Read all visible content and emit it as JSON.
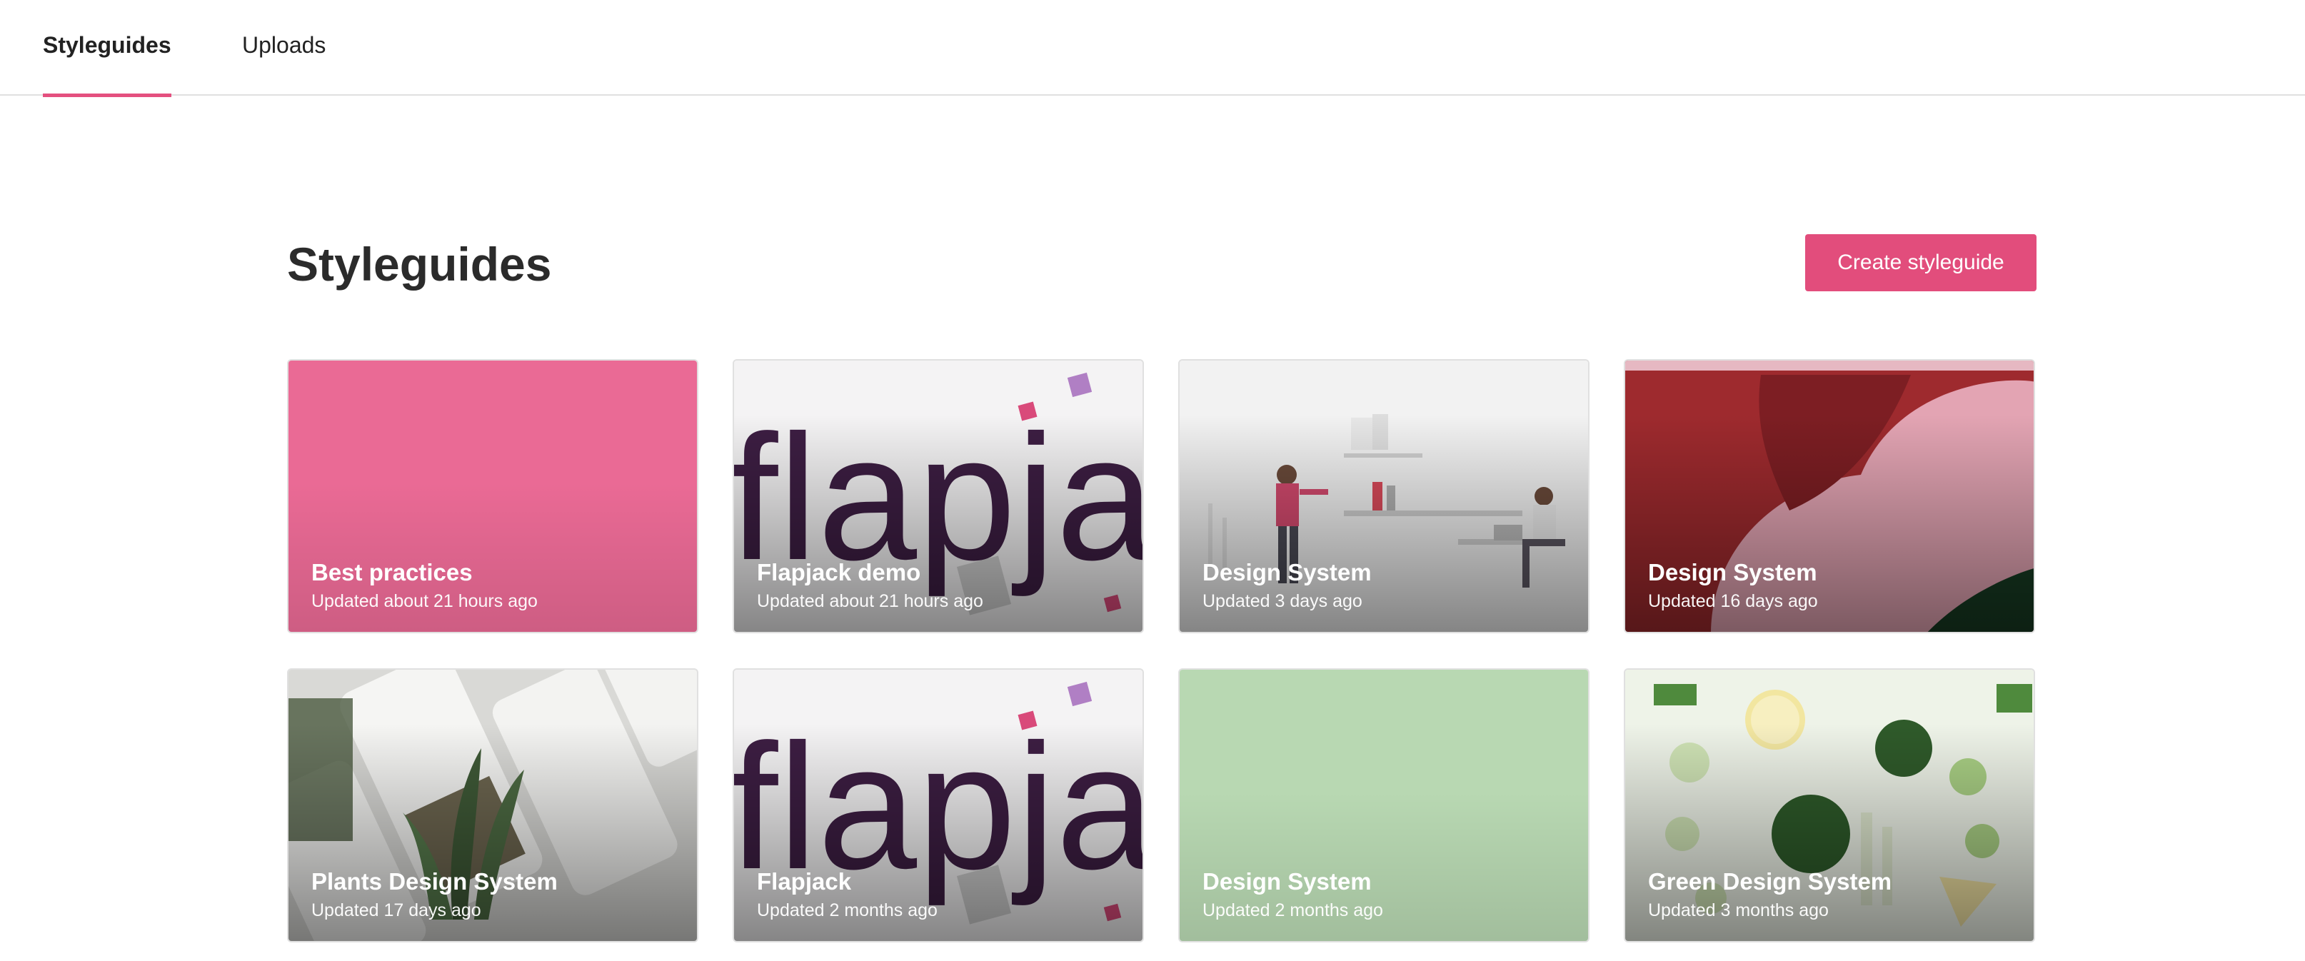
{
  "nav": {
    "tabs": [
      {
        "label": "Styleguides",
        "active": true
      },
      {
        "label": "Uploads",
        "active": false
      }
    ]
  },
  "header": {
    "title": "Styleguides",
    "create_label": "Create styleguide"
  },
  "colors": {
    "accent": "#e24d7c",
    "card_pink": "#ea6a95",
    "card_green": "#b8d8b2",
    "flapjack_text": "#3d1e43"
  },
  "cards": [
    {
      "title": "Best practices",
      "updated": "Updated about 21 hours ago",
      "image": "solid-pink"
    },
    {
      "title": "Flapjack demo",
      "updated": "Updated about 21 hours ago",
      "image": "flapjack-logo"
    },
    {
      "title": "Design System",
      "updated": "Updated 3 days ago",
      "image": "office-illustration"
    },
    {
      "title": "Design System",
      "updated": "Updated 16 days ago",
      "image": "abstract-red-pink"
    },
    {
      "title": "Plants Design System",
      "updated": "Updated 17 days ago",
      "image": "plants-phones"
    },
    {
      "title": "Flapjack",
      "updated": "Updated 2 months ago",
      "image": "flapjack-logo"
    },
    {
      "title": "Design System",
      "updated": "Updated 2 months ago",
      "image": "solid-green"
    },
    {
      "title": "Green Design System",
      "updated": "Updated 3 months ago",
      "image": "green-vegetables"
    }
  ],
  "flapjack_logo_text": "flapjack"
}
